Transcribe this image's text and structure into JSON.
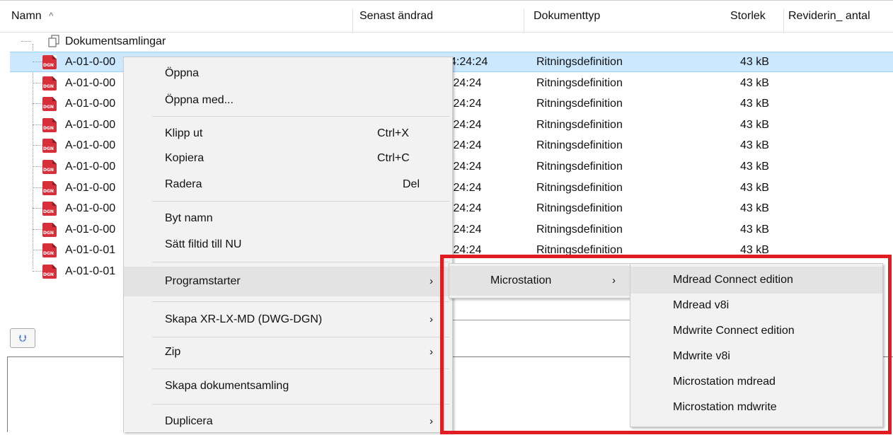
{
  "columns": {
    "name": "Namn",
    "name_sort": "^",
    "modified": "Senast ändrad",
    "doctype": "Dokumenttyp",
    "size": "Storlek",
    "revisions": "Reviderin_ antal"
  },
  "collections": {
    "label": "Dokumentsamlingar",
    "icon": "document-collection-icon"
  },
  "file_icon": {
    "name": "dgn-file-icon",
    "text": "DGN"
  },
  "files": [
    {
      "name_start": "A-01-0-00",
      "time": "4:24:24",
      "type": "Ritningsdefinition",
      "size": "43 kB"
    },
    {
      "name_start": "A-01-0-00",
      "time": ":24:24",
      "type": "Ritningsdefinition",
      "size": "43 kB"
    },
    {
      "name_start": "A-01-0-00",
      "time": ":24:24",
      "type": "Ritningsdefinition",
      "size": "43 kB"
    },
    {
      "name_start": "A-01-0-00",
      "time": ":24:24",
      "type": "Ritningsdefinition",
      "size": "43 kB"
    },
    {
      "name_start": "A-01-0-00",
      "time": ":24:24",
      "type": "Ritningsdefinition",
      "size": "43 kB"
    },
    {
      "name_start": "A-01-0-00",
      "time": ":24:24",
      "type": "Ritningsdefinition",
      "size": "43 kB"
    },
    {
      "name_start": "A-01-0-00",
      "time": ":24:24",
      "type": "Ritningsdefinition",
      "size": "43 kB"
    },
    {
      "name_start": "A-01-0-00",
      "time": ":24:24",
      "type": "Ritningsdefinition",
      "size": "43 kB"
    },
    {
      "name_start": "A-01-0-00",
      "time": ":24:24",
      "type": "Ritningsdefinition",
      "size": "43 kB"
    },
    {
      "name_start": "A-01-0-01",
      "time": ":24:24",
      "type": "Ritningsdefinition",
      "size": "43 kB"
    },
    {
      "name_start": "A-01-0-01",
      "time": "",
      "type": "",
      "size": ""
    }
  ],
  "context_menu": {
    "open": "Öppna",
    "open_with": "Öppna med...",
    "cut": "Klipp ut",
    "cut_shortcut": "Ctrl+X",
    "copy": "Kopiera",
    "copy_shortcut": "Ctrl+C",
    "delete": "Radera",
    "delete_shortcut": "Del",
    "rename": "Byt namn",
    "set_filetime": "Sätt filtid till NU",
    "program_launcher": "Programstarter",
    "create_xr": "Skapa XR-LX-MD (DWG-DGN)",
    "zip": "Zip",
    "create_collection": "Skapa dokumentsamling",
    "duplicate": "Duplicera"
  },
  "submenu_1": {
    "microstation": "Microstation"
  },
  "submenu_2": {
    "items": [
      "Mdread Connect edition",
      "Mdread v8i",
      "Mdwrite Connect edition",
      "Mdwrite v8i",
      "Microstation mdread",
      "Microstation mdwrite"
    ]
  },
  "chevron": "›",
  "colors": {
    "selection": "#cce8ff",
    "highlight": "#e01b22",
    "menu_bg": "#f2f2f2"
  }
}
